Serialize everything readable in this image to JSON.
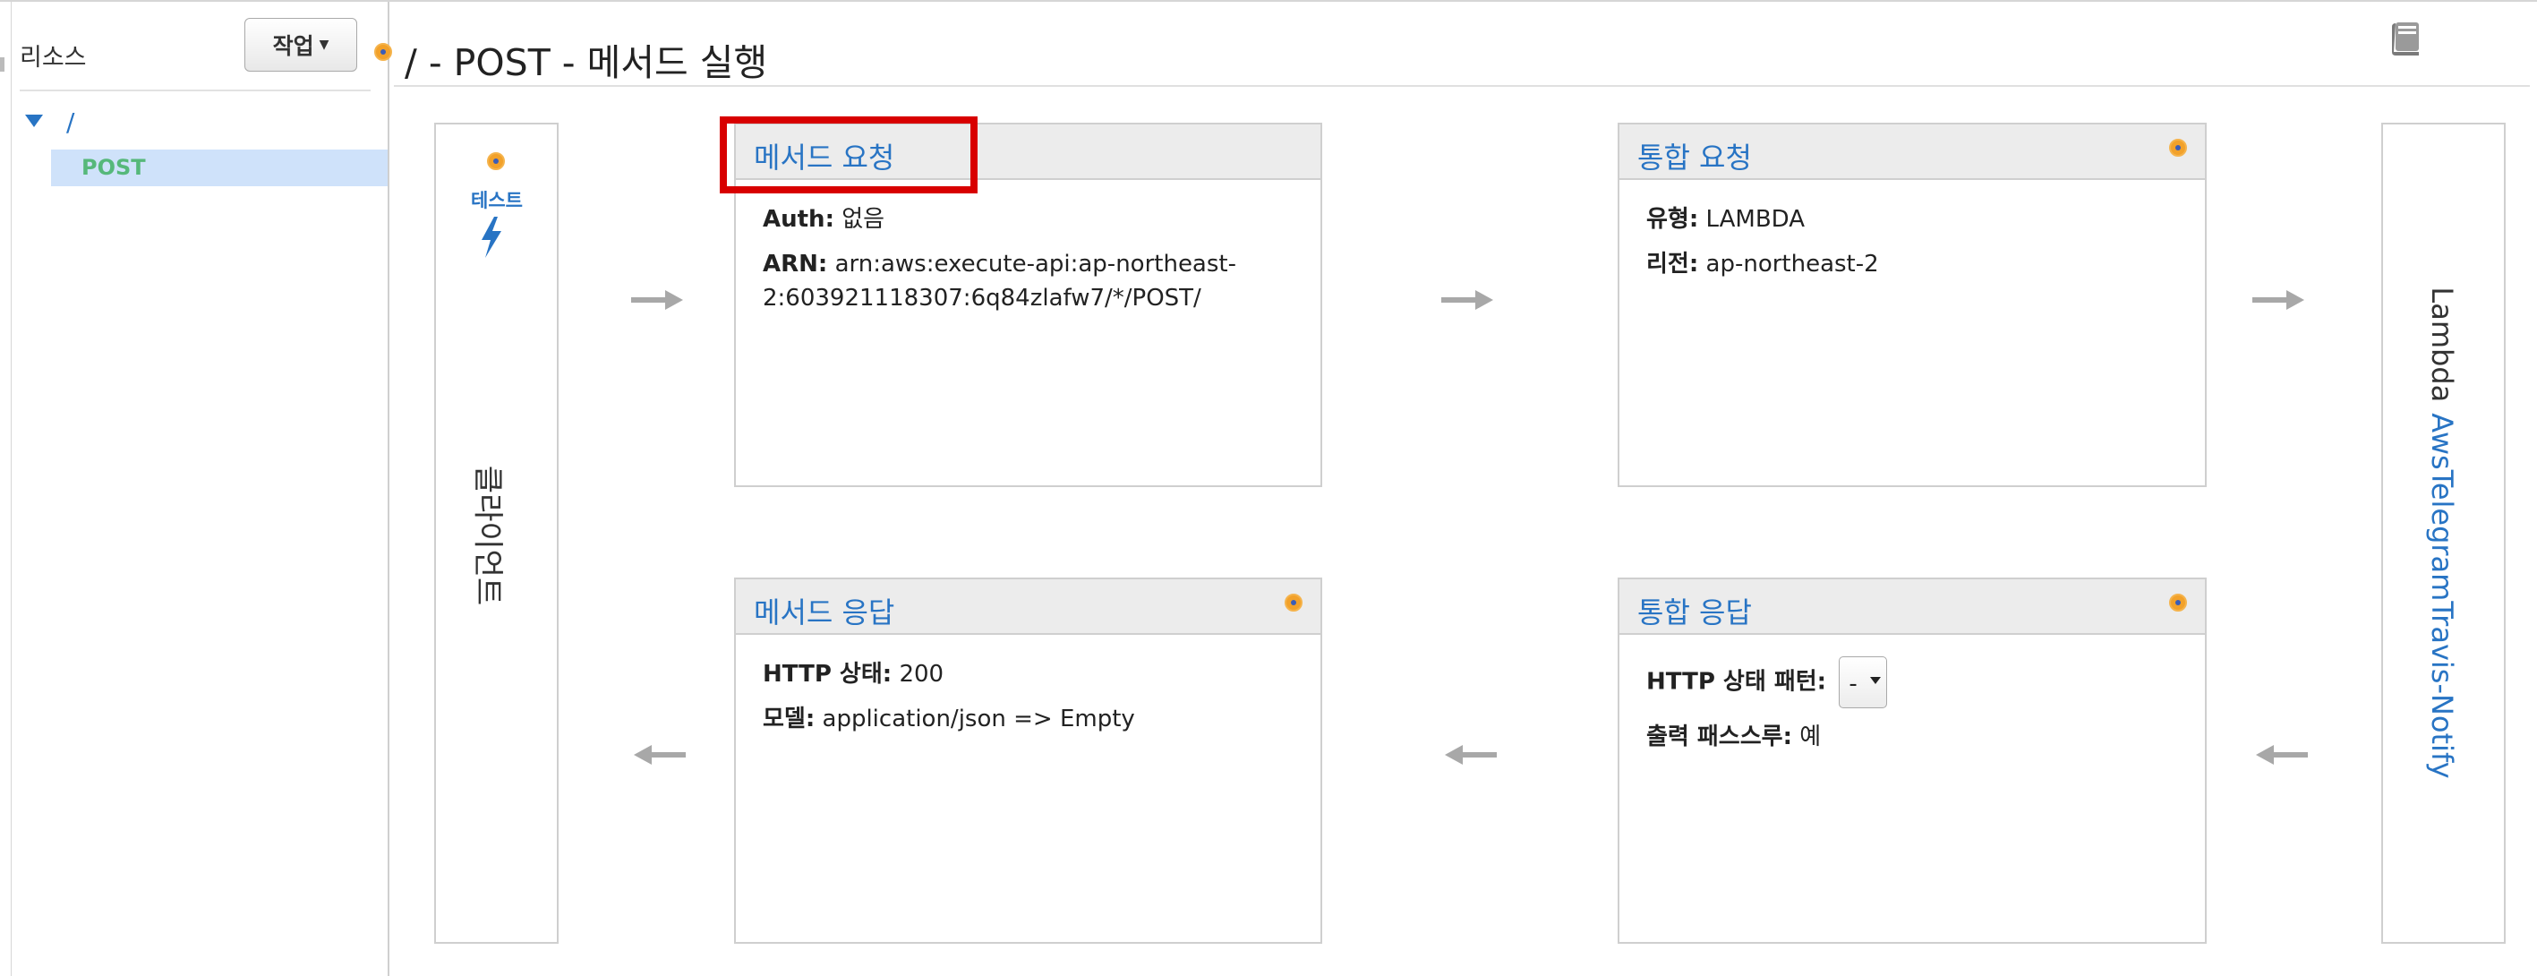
{
  "sidebar": {
    "title": "리소스",
    "actions_label": "작업",
    "tree": {
      "root": "/",
      "selected_method": "POST"
    }
  },
  "page": {
    "title": "/ - POST - 메서드 실행"
  },
  "client": {
    "test_label": "테스트",
    "label": "클라이언트"
  },
  "method_request": {
    "title": "메서드 요청",
    "auth_label": "Auth:",
    "auth_value": "없음",
    "arn_label": "ARN:",
    "arn_value_1": "arn:aws:execute-api:ap-northeast-",
    "arn_value_2": "2:603921118307:6q84zlafw7/*/POST/"
  },
  "integration_request": {
    "title": "통합 요청",
    "type_label": "유형:",
    "type_value": "LAMBDA",
    "region_label": "리전:",
    "region_value": "ap-northeast-2"
  },
  "method_response": {
    "title": "메서드 응답",
    "status_label": "HTTP 상태:",
    "status_value": "200",
    "model_label": "모델:",
    "model_value": "application/json => Empty"
  },
  "integration_response": {
    "title": "통합 응답",
    "pattern_label": "HTTP 상태 패턴:",
    "pattern_value": "-",
    "passthrough_label": "출력 패스스루:",
    "passthrough_value": "예"
  },
  "lambda": {
    "prefix": "Lambda",
    "function_name": "AwsTelegramTravis-Notify"
  },
  "colors": {
    "link": "#2874c4",
    "method_green": "#56b87a",
    "highlight": "#d80000",
    "dot": "#f2a12a"
  },
  "icons": [
    "book-icon",
    "lightning-icon",
    "arrow-right-icon",
    "arrow-left-icon",
    "caret-down-icon",
    "info-dot-icon"
  ]
}
